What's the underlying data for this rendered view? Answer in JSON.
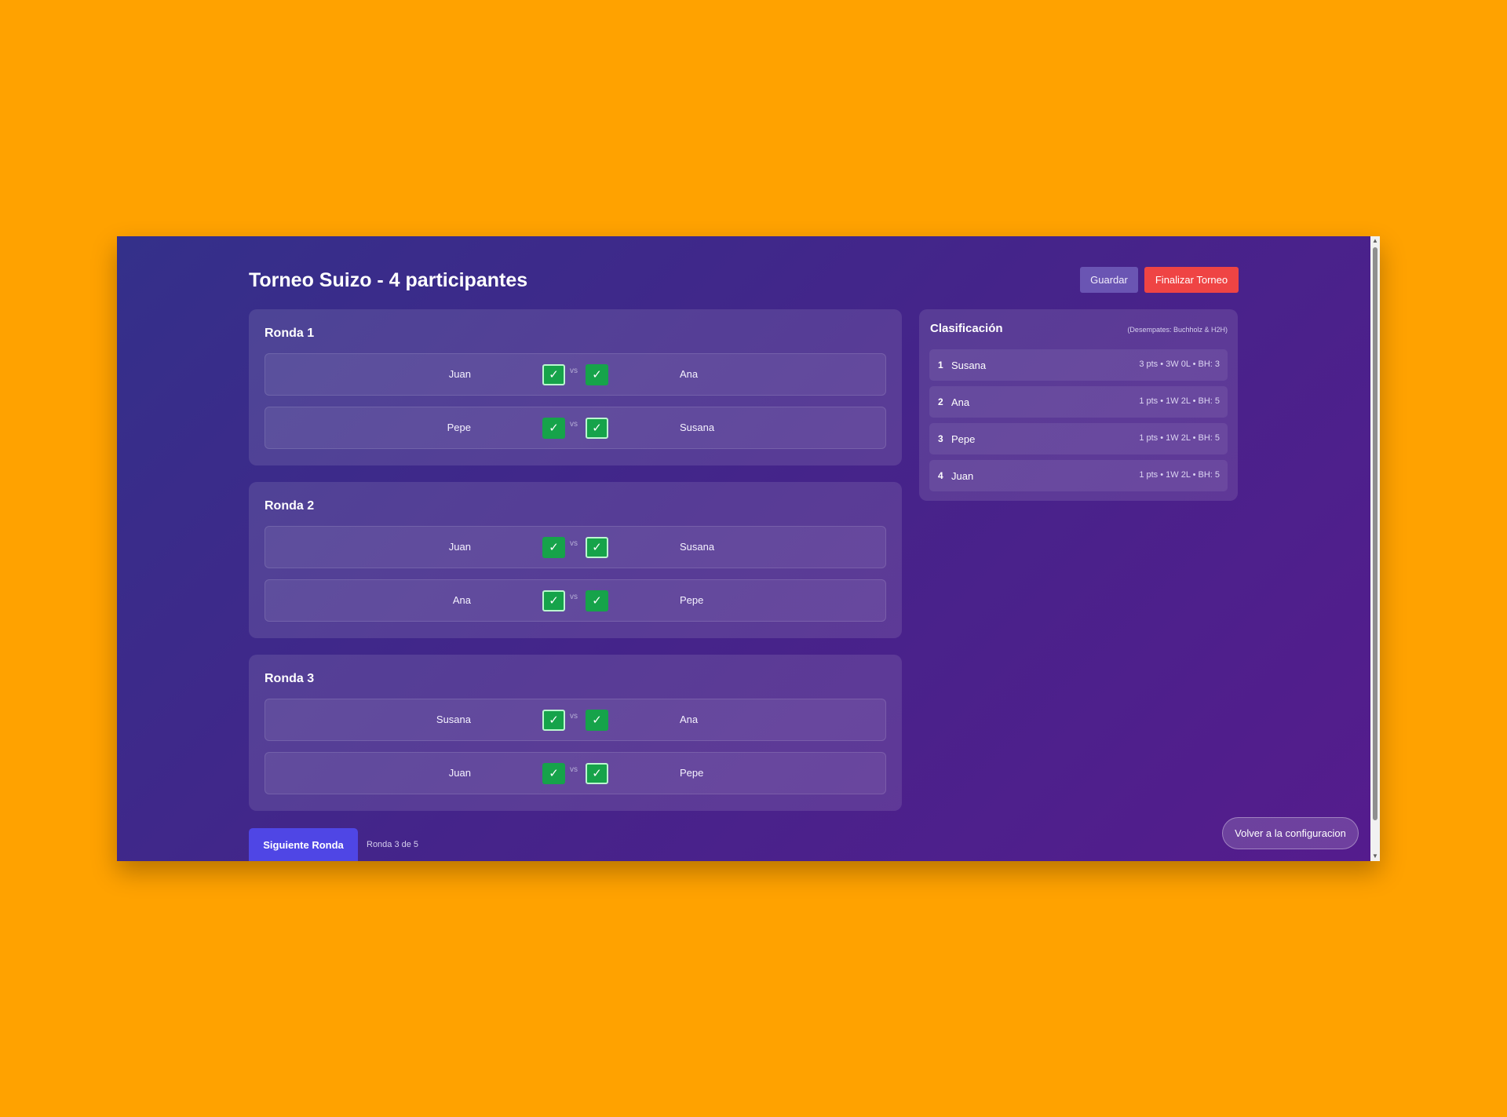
{
  "header": {
    "title": "Torneo Suizo - 4 participantes",
    "save_label": "Guardar",
    "finish_label": "Finalizar Torneo"
  },
  "rounds": [
    {
      "title": "Ronda 1",
      "matches": [
        {
          "left": "Juan",
          "right": "Ana",
          "left_mark": "✓",
          "right_mark": "✓",
          "vs": "vs"
        },
        {
          "left": "Pepe",
          "right": "Susana",
          "left_mark": "✓",
          "right_mark": "✓",
          "vs": "vs"
        }
      ]
    },
    {
      "title": "Ronda 2",
      "matches": [
        {
          "left": "Juan",
          "right": "Susana",
          "left_mark": "✓",
          "right_mark": "✓",
          "vs": "vs"
        },
        {
          "left": "Ana",
          "right": "Pepe",
          "left_mark": "✓",
          "right_mark": "✓",
          "vs": "vs"
        }
      ]
    },
    {
      "title": "Ronda 3",
      "matches": [
        {
          "left": "Susana",
          "right": "Ana",
          "left_mark": "✓",
          "right_mark": "✓",
          "vs": "vs"
        },
        {
          "left": "Juan",
          "right": "Pepe",
          "left_mark": "✓",
          "right_mark": "✓",
          "vs": "vs"
        }
      ]
    }
  ],
  "standings": {
    "title": "Clasificación",
    "note": "(Desempates: Buchholz & H2H)",
    "rows": [
      {
        "rank": "1",
        "name": "Susana",
        "stats": "3 pts • 3W 0L • BH: 3"
      },
      {
        "rank": "2",
        "name": "Ana",
        "stats": "1 pts • 1W 2L • BH: 5"
      },
      {
        "rank": "3",
        "name": "Pepe",
        "stats": "1 pts • 1W 2L • BH: 5"
      },
      {
        "rank": "4",
        "name": "Juan",
        "stats": "1 pts • 1W 2L • BH: 5"
      }
    ]
  },
  "footer": {
    "next_label": "Siguiente Ronda",
    "round_status": "Ronda 3 de 5",
    "back_label": "Volver a la configuracion"
  },
  "colors": {
    "page_background": "#FFA200",
    "accent": "#4f46e5",
    "danger": "#ef4444",
    "success": "#16a34a"
  }
}
